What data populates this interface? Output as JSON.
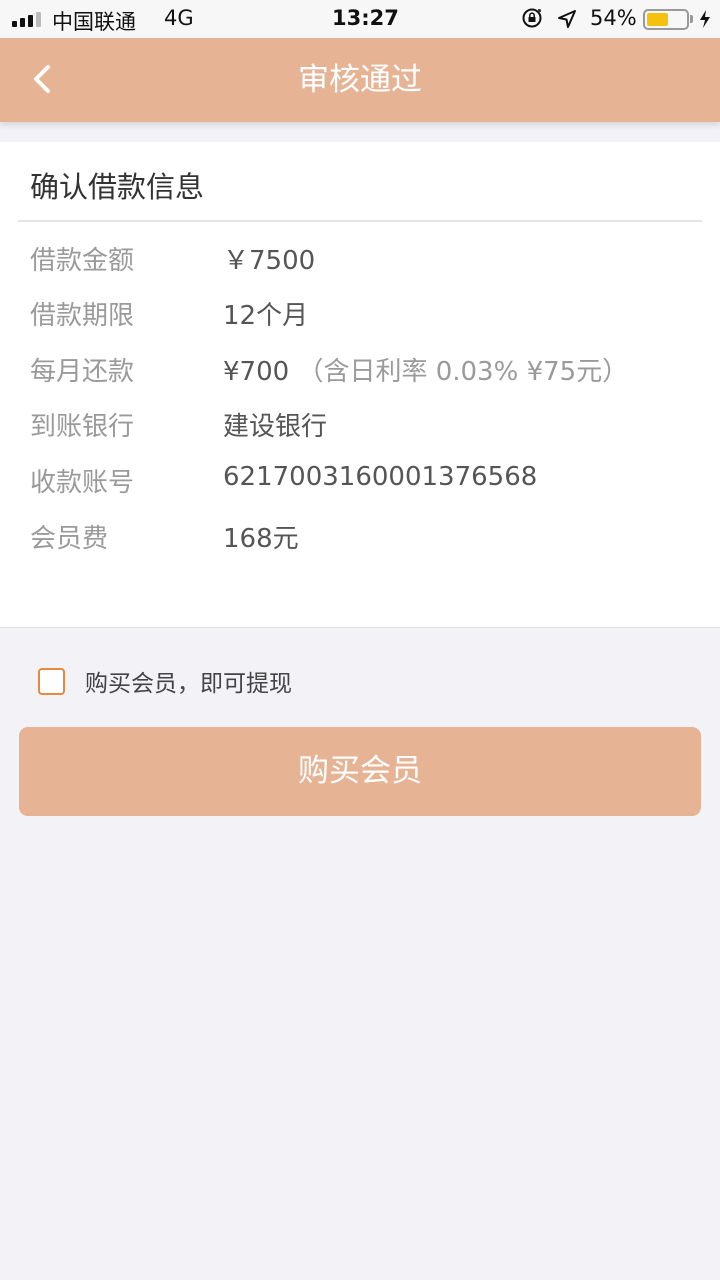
{
  "status_bar": {
    "carrier": "中国联通",
    "network": "4G",
    "time": "13:27",
    "battery_percent": "54%",
    "battery_level": 0.54,
    "icons": [
      "signal-icon",
      "rotation-lock-icon",
      "location-arrow-icon",
      "battery-icon",
      "charging-bolt-icon"
    ]
  },
  "nav": {
    "back_icon": "chevron-left-icon",
    "title": "审核通过"
  },
  "card": {
    "title": "确认借款信息",
    "rows": [
      {
        "label": "借款金额",
        "value": "￥7500",
        "note": ""
      },
      {
        "label": "借款期限",
        "value": "12个月",
        "note": ""
      },
      {
        "label": "每月还款",
        "value": "¥700",
        "note": "（含日利率 0.03% ¥75元）"
      },
      {
        "label": "到账银行",
        "value": "建设银行",
        "note": ""
      },
      {
        "label": "收款账号",
        "value": "6217003160001376568",
        "note": ""
      },
      {
        "label": "会员费",
        "value": "168元",
        "note": ""
      }
    ]
  },
  "agreement": {
    "checked": false,
    "label": "购买会员，即可提现"
  },
  "buy_button": {
    "label": "购买会员"
  },
  "colors": {
    "accent": "#e6b394",
    "checkbox_border": "#e68a3e",
    "background": "#f2f2f7"
  }
}
